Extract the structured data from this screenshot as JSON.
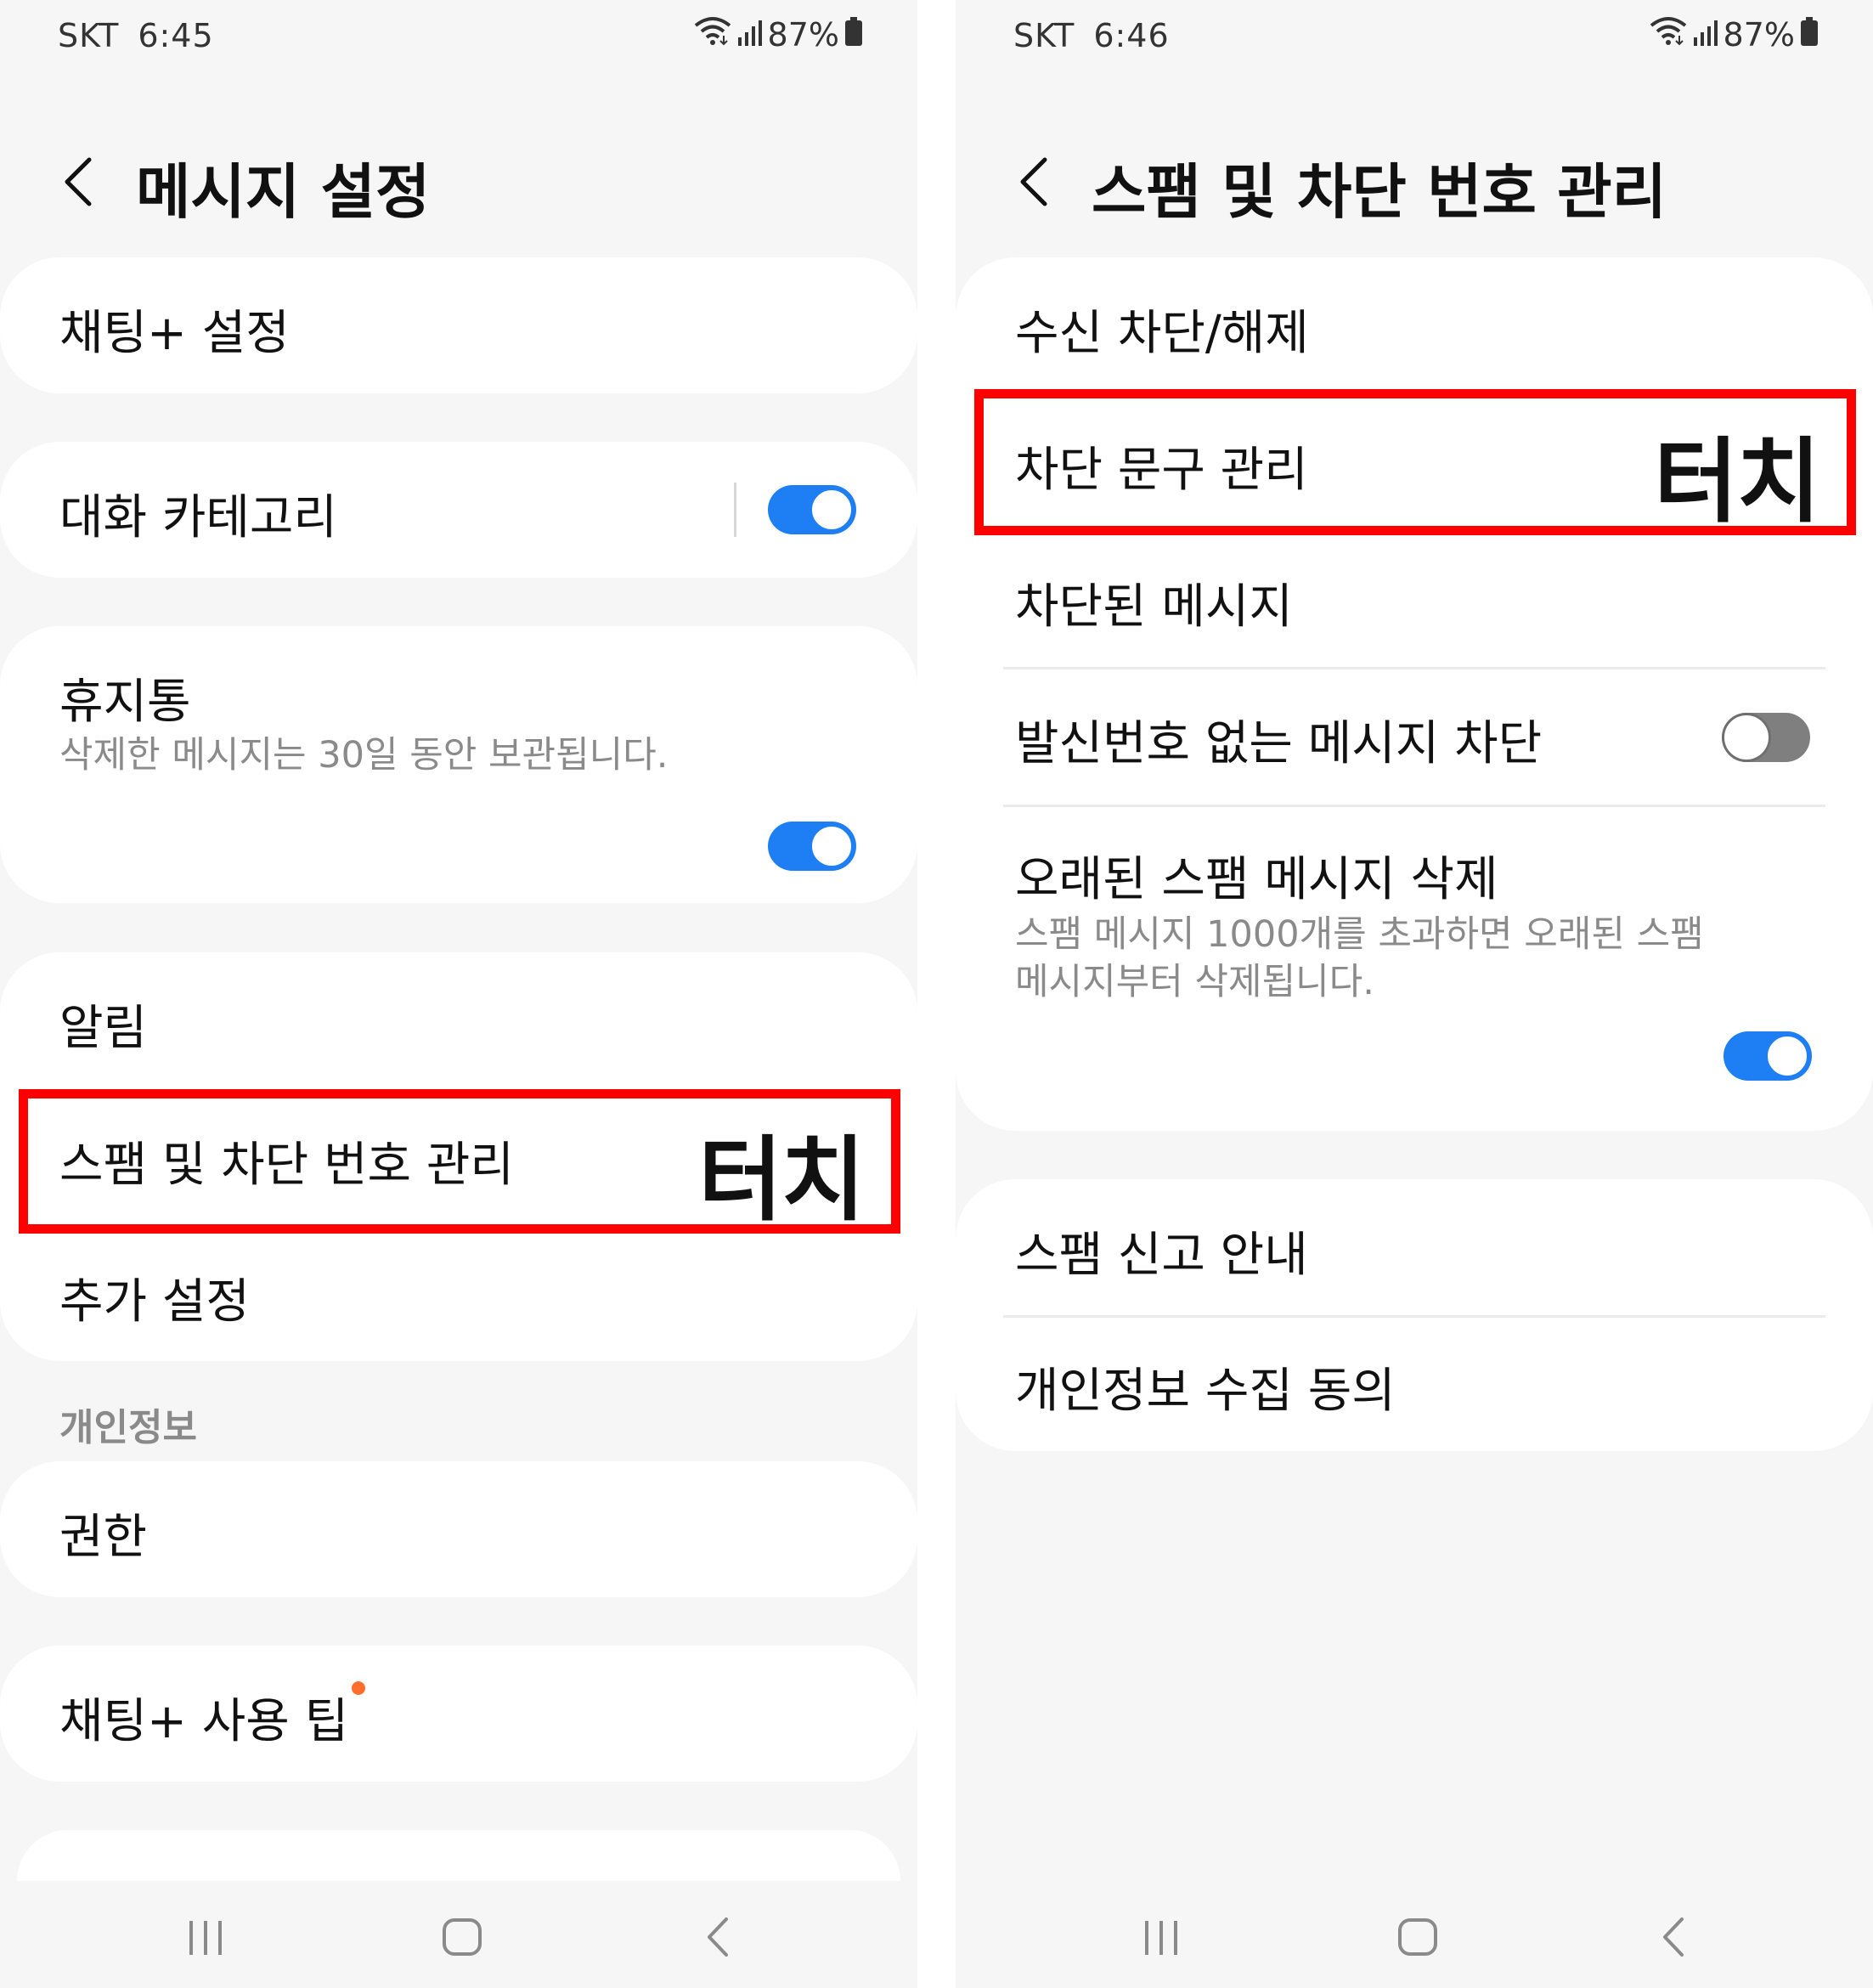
{
  "left": {
    "status": {
      "carrier": "SKT",
      "time": "6:45",
      "battery": "87%"
    },
    "title": "메시지 설정",
    "items": {
      "chat_plus": "채팅+ 설정",
      "conversation_category": "대화 카테고리",
      "trash": "휴지통",
      "trash_desc": "삭제한 메시지는 30일 동안 보관됩니다.",
      "notifications": "알림",
      "spam_block": "스팸 및 차단 번호 관리",
      "more_settings": "추가 설정",
      "privacy_section": "개인정보",
      "permissions": "권한",
      "chat_plus_tips": "채팅+ 사용 팁"
    },
    "toggles": {
      "conversation_category": true,
      "trash": true
    },
    "touch_label": "터치"
  },
  "right": {
    "status": {
      "carrier": "SKT",
      "time": "6:46",
      "battery": "87%"
    },
    "title": "스팸 및 차단 번호 관리",
    "items": {
      "block_unblock": "수신 차단/해제",
      "blocked_phrases": "차단 문구 관리",
      "blocked_messages": "차단된 메시지",
      "block_unknown_sender": "발신번호 없는 메시지 차단",
      "delete_old_spam": "오래된 스팸 메시지 삭제",
      "delete_old_spam_desc_1": "스팸 메시지 1000개를 초과하면 오래된 스팸",
      "delete_old_spam_desc_2": "메시지부터 삭제됩니다.",
      "spam_report_guide": "스팸 신고 안내",
      "privacy_consent": "개인정보 수집 동의"
    },
    "toggles": {
      "block_unknown_sender": false,
      "delete_old_spam": true
    },
    "touch_label": "터치"
  },
  "colors": {
    "accent": "#1e7ef4",
    "highlight": "#ff0000",
    "badge": "#ff6f2b"
  },
  "icons": {
    "back": "chevron-left-icon",
    "wifi": "wifi-icon",
    "signal": "signal-icon",
    "battery": "battery-icon",
    "recents": "recents-icon",
    "home": "home-icon",
    "nav_back": "nav-back-icon"
  }
}
